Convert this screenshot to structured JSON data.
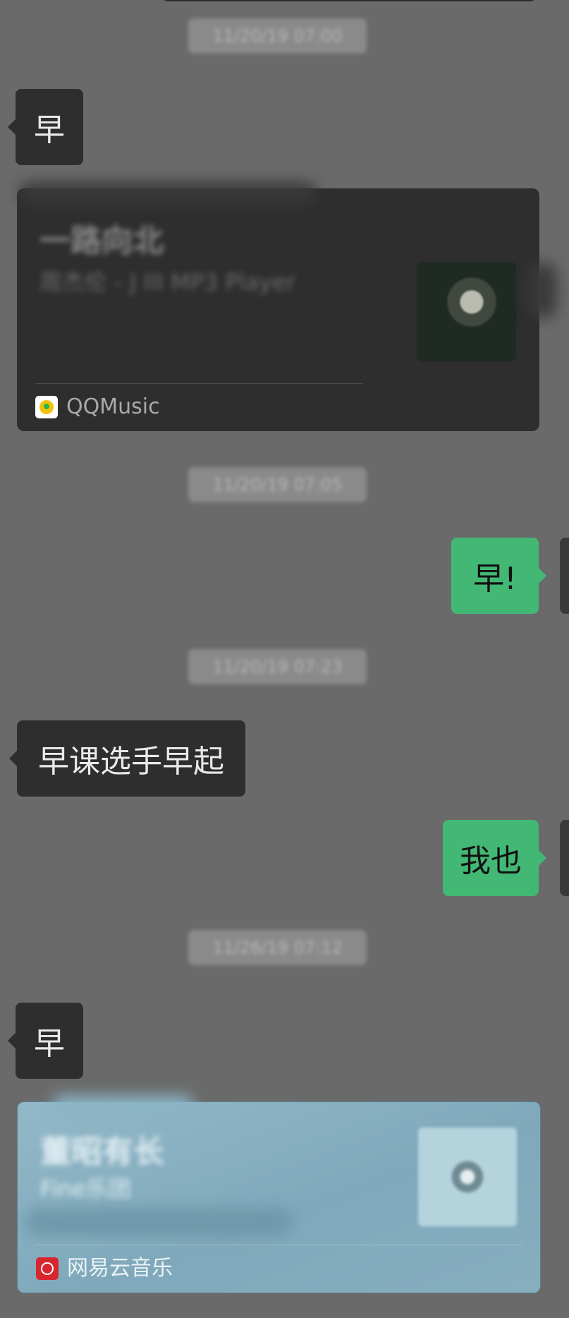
{
  "timestamps": [
    "11/20/19 07:00",
    "11/20/19 07:05",
    "11/20/19 07:23",
    "11/26/19 07:12"
  ],
  "messages": {
    "m1": "早",
    "m2": "早!",
    "m3": "早课选手早起",
    "m4": "我也",
    "m5": "早"
  },
  "qq_card": {
    "title": "一路向北",
    "subtitle": "周杰伦 - J III MP3 Player",
    "source": "QQMusic"
  },
  "netease_card": {
    "title": "董昭有长",
    "subtitle": "Fine乐团",
    "source": "网易云音乐"
  },
  "icons": [
    "qqmusic-logo-icon",
    "netease-music-logo-icon",
    "album-cover-thumbnail"
  ],
  "colors": {
    "background": "#6a6a6a",
    "incoming_bubble": "#2e2e2e",
    "outgoing_bubble": "#43b875",
    "netease_card": "#86aebf",
    "netease_logo": "#d8262f",
    "qqmusic_logo": "#f3c20c"
  }
}
